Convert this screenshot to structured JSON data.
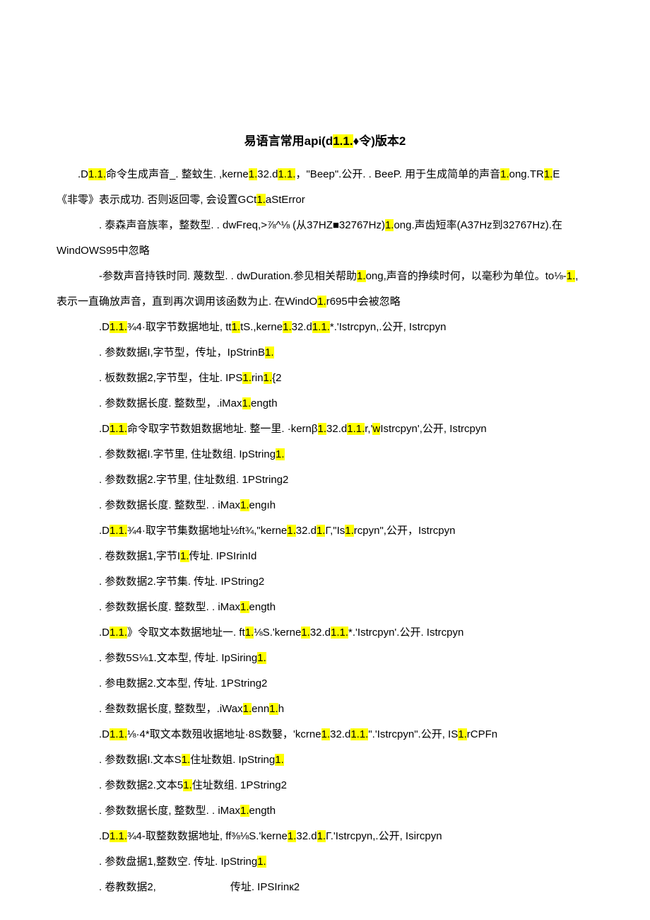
{
  "title_pre": "易语言常用api(d",
  "title_hl1": "1.1.",
  "title_post": "♦令)版本2",
  "lines": [
    {
      "type": "para",
      "segs": [
        ".D",
        "1.1.",
        "命令生成声音_. 整蚊生. ,kerne",
        "1.",
        "32.d",
        "1.1.",
        "，\"Beep\".公开. . BeeP. 用于生成简单的声音",
        "1.",
        "ong.TR",
        "1.",
        "E"
      ]
    },
    {
      "type": "plain",
      "segs": [
        "《非零》表示成功. 否则返回零, 会设置GCt",
        "1.",
        "aStError"
      ]
    },
    {
      "type": "para-deep",
      "segs": [
        ". 泰森声音族率，整数型. . dwFreq,>⅞^⅛ (从37HZ■32767Hz)",
        "1.",
        "ong.声齿短率(A37Hz到32767Hz).在"
      ]
    },
    {
      "type": "plain",
      "segs": [
        "WindOWS95中忽略"
      ]
    },
    {
      "type": "para-deep",
      "segs": [
        "-参数声音持铁时同. 蔑数型. . dwDuration.参见相关帮助",
        "1.",
        "ong,声音的挣续时何，以毫秒为单位。to⅛-",
        "1.",
        ","
      ]
    },
    {
      "type": "plain",
      "segs": [
        "表示一直确放声音，直到再次调用该函数为止. 在WindO",
        "1.",
        "r695中会被忽略"
      ]
    },
    {
      "type": "para-deep",
      "segs": [
        ".D",
        "1.1.",
        "¾4·取字节数据地址, tt",
        "1.",
        "tS.,kerne",
        "1.",
        "32.d",
        "1.1.",
        "*.'Istrcpyn,.公开, Istrcpyn"
      ]
    },
    {
      "type": "para-deep",
      "segs": [
        ". 参数数据I,字节型，传址，IpStrinB",
        "1."
      ]
    },
    {
      "type": "para-deep",
      "segs": [
        ". 板数数据2,字节型，住址. IPS",
        "1.",
        "rin",
        "1.",
        "{2"
      ]
    },
    {
      "type": "para-deep",
      "segs": [
        ". 参数数据长度. 整数型，.iMax",
        "1.",
        "ength"
      ]
    },
    {
      "type": "para-deep",
      "segs": [
        ".D",
        "1.1.",
        "命令取字节数姐数据地址. 整一里. ·kernβ",
        "1.",
        "32.d",
        "1.1.",
        "r,'",
        "w",
        "Istrcpyn',公开, Istrcpyn"
      ]
    },
    {
      "type": "para-deep",
      "segs": [
        ". 参数数裾I.字节里, 住址数组. IpString",
        "1."
      ]
    },
    {
      "type": "para-deep",
      "segs": [
        ". 参数数据2.字节里, 住址数组. 1PString2"
      ]
    },
    {
      "type": "para-deep",
      "segs": [
        ". 参数数据长度. 整数型. . iMax",
        "1.",
        "engıh"
      ]
    },
    {
      "type": "para-deep",
      "segs": [
        ".D",
        "1.1.",
        "¾4·取字节集数据地址½ft¾,\"kerne",
        "1.",
        "32.d",
        "1.",
        "Γ,\"Is",
        "1.",
        "rcpyn\",公开，Istrcpyn"
      ]
    },
    {
      "type": "para-deep",
      "segs": [
        ". 卷数数据1,字节I",
        "1.",
        "传址. IPSIrinId"
      ]
    },
    {
      "type": "para-deep",
      "segs": [
        ". 参数数据2.字节集. 传址. IPString2"
      ]
    },
    {
      "type": "para-deep",
      "segs": [
        ". 参数数据长度. 整数型. . iMax",
        "1.",
        "ength"
      ]
    },
    {
      "type": "para-deep",
      "segs": [
        ".D",
        "1.1.",
        "》令取文本数据地址一. ft",
        "1.",
        "⅛S.'kerne",
        "1.",
        "32.d",
        "1.1.",
        "*.'Istrcpyn'.公开. Istrcpyn"
      ]
    },
    {
      "type": "para-deep",
      "segs": [
        ". 参数5S⅛1.文本型, 传址. IpSiring",
        "1."
      ]
    },
    {
      "type": "para-deep",
      "segs": [
        ". 参电数据2.文本型, 传址. 1PString2"
      ]
    },
    {
      "type": "para-deep",
      "segs": [
        ". 叁数数据长度, 整数型，.iWax",
        "1.",
        "enn",
        "1.",
        "h"
      ]
    },
    {
      "type": "para-deep",
      "segs": [
        ".D",
        "1.1.",
        "⅛·4*取文本数殂收据地址·8S数嫛，'kcrne",
        "1.",
        "32.d",
        "1.1.",
        "\".'Istrcpyn\".公开, IS",
        "1.",
        "rCPFn"
      ]
    },
    {
      "type": "para-deep",
      "segs": [
        ". 参数数据I.文本S",
        "1.",
        "住址数姐. IpString",
        "1."
      ]
    },
    {
      "type": "para-deep",
      "segs": [
        ". 参数数据2.文本5",
        "1.",
        "住址数组. 1PString2"
      ]
    },
    {
      "type": "para-deep",
      "segs": [
        ". 参数数据长度, 整数型. . iMax",
        "1.",
        "ength"
      ]
    },
    {
      "type": "para-deep",
      "segs": [
        ".D",
        "1.1.",
        "¾4-取整数数据地址, ff⅜⅛S.'kerne",
        "1.",
        "32.d",
        "1.",
        "Γ.'Istrcpyn,.公开, Isircpyn"
      ]
    },
    {
      "type": "para-deep",
      "segs": [
        ". 参数盘据1,整数空. 传址. IpString",
        "1."
      ]
    },
    {
      "type": "para-deep",
      "segs": [
        ". 卷教数据2,       传址. IPSIrinк2"
      ]
    }
  ]
}
